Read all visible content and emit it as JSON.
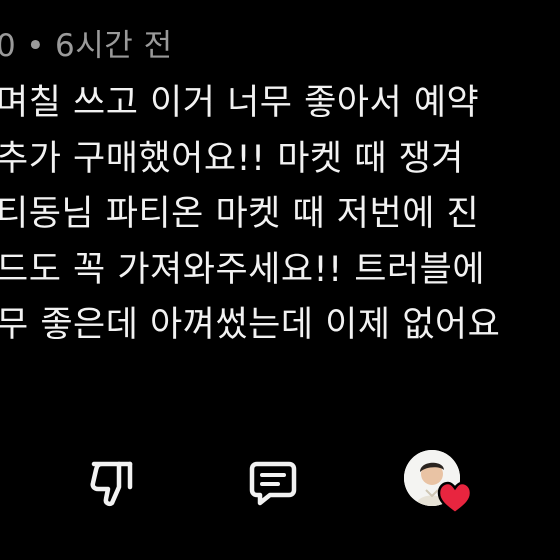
{
  "comment": {
    "meta_left": "0",
    "separator": "•",
    "timestamp": "6시간 전",
    "lines": [
      "며칠 쓰고 이거 너무 좋아서 예약",
      "추가 구매했어요!! 마켓 때 쟁겨",
      "티동님 파티온 마켓 때 저번에 진",
      "드도 꼭 가져와주세요!! 트러블에",
      "무 좋은데 아껴썼는데 이제 없어요"
    ]
  },
  "actions": {
    "dislike_icon": "thumbs-down-icon",
    "reply_icon": "comment-icon",
    "creator_heart_icon": "heart-icon",
    "heart_color": "#e8253f"
  }
}
